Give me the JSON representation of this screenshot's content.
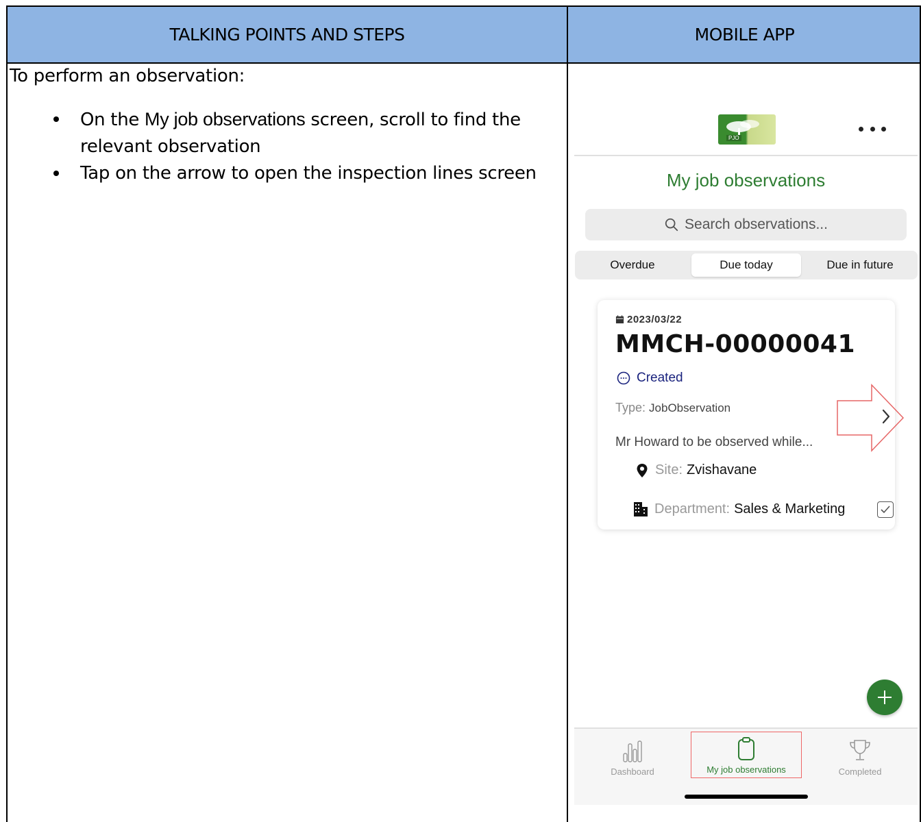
{
  "table": {
    "header_left": "TALKING POINTS AND STEPS",
    "header_right": "MOBILE APP"
  },
  "steps": {
    "intro": "To perform an observation:",
    "bullet1_prefix": "On the ",
    "bullet1_bold": "My job observations",
    "bullet1_suffix": " screen, scroll to find the relevant observation",
    "bullet2": "Tap on the arrow to open the inspection lines screen"
  },
  "app": {
    "logo_text": "PJO",
    "title": "My job observations",
    "search_placeholder": "Search observations...",
    "segments": [
      "Overdue",
      "Due today",
      "Due in future"
    ],
    "card": {
      "date": "2023/03/22",
      "id": "MMCH-00000041",
      "status": "Created",
      "type_label": "Type:",
      "type_value": "JobObservation",
      "description": "Mr Howard to be observed while...",
      "site_label": "Site:",
      "site_value": "Zvishavane",
      "department_label": "Department:",
      "department_value": "Sales & Marketing"
    },
    "fab_label": "+",
    "tabs": [
      "Dashboard",
      "My job observations",
      "Completed"
    ]
  },
  "colors": {
    "header_bg": "#8eb4e3",
    "brand_green": "#2e7d32",
    "status_blue": "#1a237e",
    "callout_red": "#e66666"
  }
}
